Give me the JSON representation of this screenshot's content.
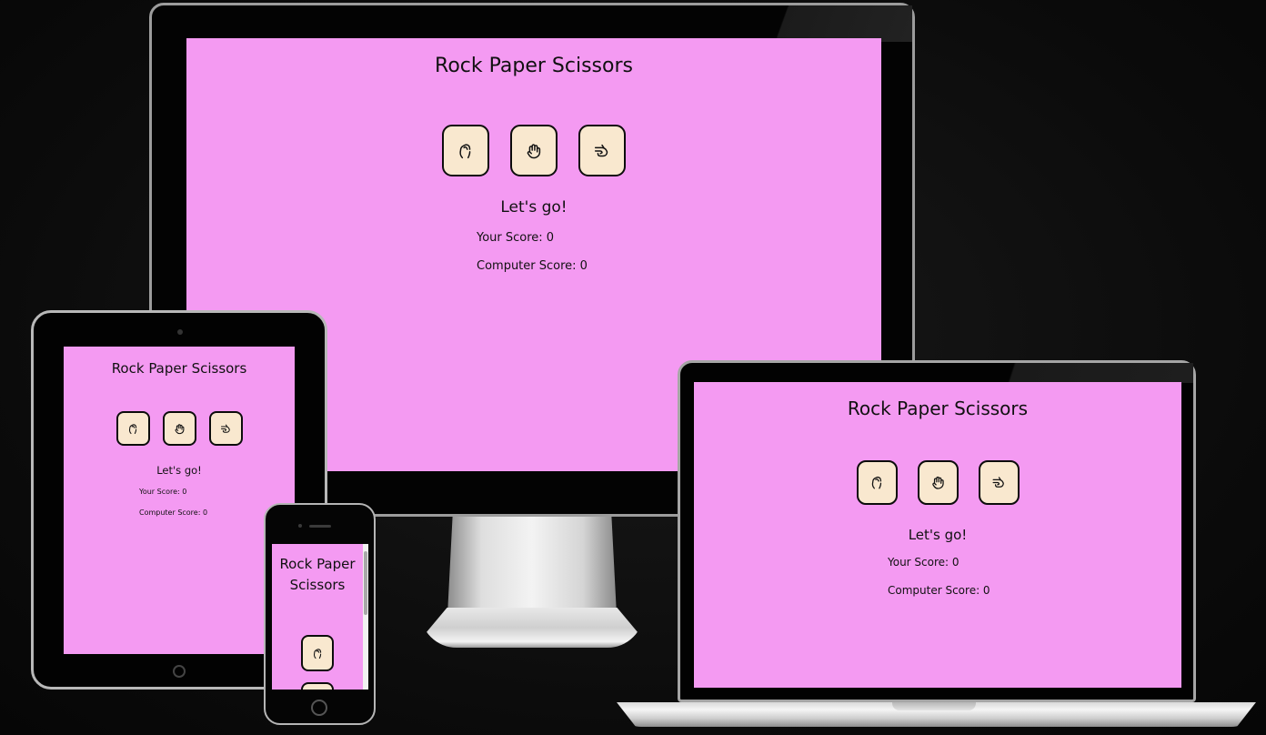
{
  "app": {
    "title": "Rock Paper Scissors",
    "result_text": "Let's go!",
    "your_score": "Your Score: 0",
    "computer_score": "Computer Score: 0",
    "choices": [
      {
        "name": "rock",
        "icon": "fist-icon"
      },
      {
        "name": "paper",
        "icon": "hand-icon"
      },
      {
        "name": "scissors",
        "icon": "scissors-hand-icon"
      }
    ]
  },
  "colors": {
    "page_background": "#f49af2",
    "button_background": "#f9e8cf",
    "button_border": "#0c0c0c",
    "mockup_background": "#0b0b0b"
  },
  "devices": [
    "monitor",
    "tablet",
    "phone",
    "laptop"
  ]
}
